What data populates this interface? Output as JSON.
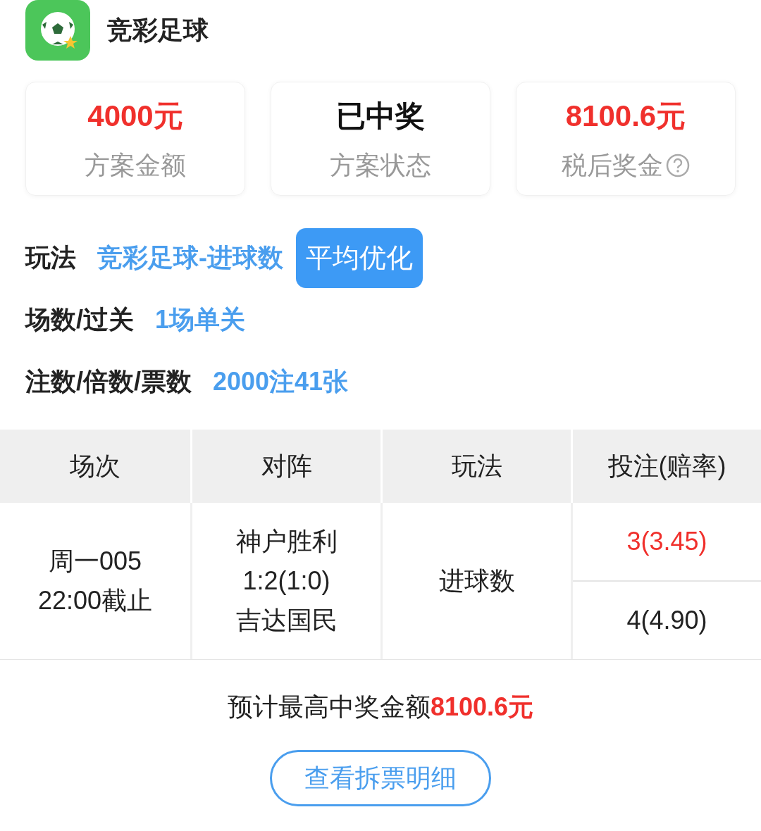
{
  "app": {
    "title": "竞彩足球"
  },
  "summary": [
    {
      "value": "4000元",
      "label": "方案金额",
      "highlight": true,
      "help": false
    },
    {
      "value": "已中奖",
      "label": "方案状态",
      "highlight": false,
      "help": false
    },
    {
      "value": "8100.6元",
      "label": "税后奖金",
      "highlight": true,
      "help": true
    }
  ],
  "info": [
    {
      "label": "玩法",
      "value": "竞彩足球-进球数",
      "badge": "平均优化"
    },
    {
      "label": "场数/过关",
      "value": "1场单关"
    },
    {
      "label": "注数/倍数/票数",
      "value": "2000注41张"
    }
  ],
  "table": {
    "columns": [
      "场次",
      "对阵",
      "玩法",
      "投注(赔率)"
    ],
    "rows": [
      {
        "match_no": "周一005",
        "deadline": "22:00截止",
        "home": "神户胜利",
        "score": "1:2(1:0)",
        "away": "吉达国民",
        "play": "进球数",
        "bets": [
          {
            "text": "3(3.45)",
            "hit": true
          },
          {
            "text": "4(4.90)",
            "hit": false
          }
        ]
      }
    ]
  },
  "footer": {
    "text": "预计最高中奖金额**8100.6元**",
    "button": "查看拆票明细"
  }
}
